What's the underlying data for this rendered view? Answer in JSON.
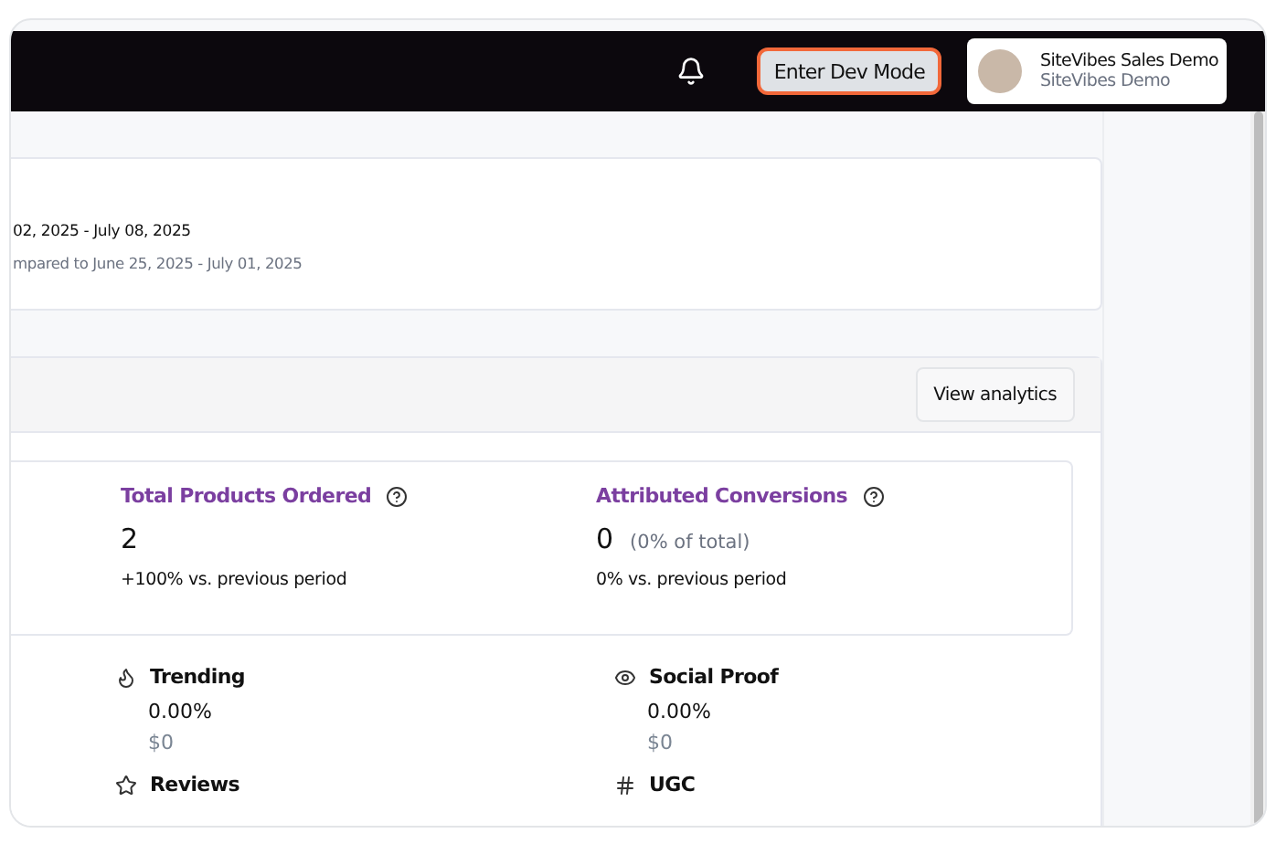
{
  "topbar": {
    "dev_mode_button": "Enter Dev Mode",
    "user": {
      "name": "SiteVibes Sales Demo",
      "organization": "SiteVibes Demo"
    }
  },
  "date_card": {
    "range": "02, 2025 - July 08, 2025",
    "comparison": "mpared to June 25, 2025 - July 01, 2025"
  },
  "analytics_card": {
    "button": "View analytics",
    "metrics": [
      {
        "title": "Total Products Ordered",
        "value": "2",
        "change": "+100% vs. previous period"
      },
      {
        "title": "Attributed Conversions",
        "value": "0",
        "share": "(0% of total)",
        "change": "0% vs. previous period"
      }
    ],
    "features": [
      {
        "kind": "trending",
        "name": "Trending",
        "rate": "0.00%",
        "revenue": "$0"
      },
      {
        "kind": "social",
        "name": "Social Proof",
        "rate": "0.00%",
        "revenue": "$0"
      },
      {
        "kind": "reviews",
        "name": "Reviews"
      },
      {
        "kind": "ugc",
        "name": "UGC"
      }
    ]
  }
}
